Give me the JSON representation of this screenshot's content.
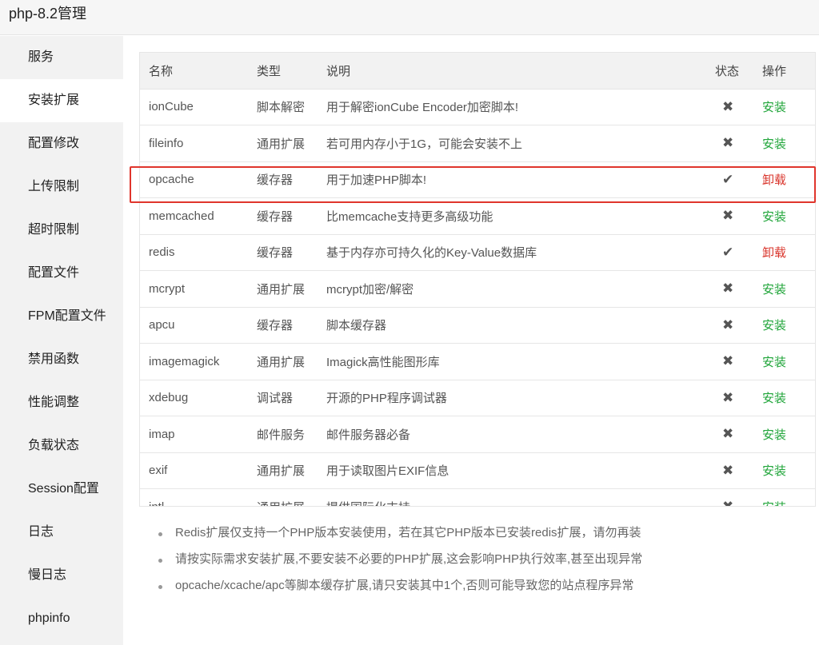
{
  "window": {
    "title": "php-8.2管理"
  },
  "sidebar": {
    "items": [
      {
        "label": "服务"
      },
      {
        "label": "安装扩展"
      },
      {
        "label": "配置修改"
      },
      {
        "label": "上传限制"
      },
      {
        "label": "超时限制"
      },
      {
        "label": "配置文件"
      },
      {
        "label": "FPM配置文件"
      },
      {
        "label": "禁用函数"
      },
      {
        "label": "性能调整"
      },
      {
        "label": "负载状态"
      },
      {
        "label": "Session配置"
      },
      {
        "label": "日志"
      },
      {
        "label": "慢日志"
      },
      {
        "label": "phpinfo"
      }
    ],
    "active_index": 1
  },
  "table": {
    "headers": {
      "name": "名称",
      "type": "类型",
      "desc": "说明",
      "status": "状态",
      "op": "操作"
    },
    "rows": [
      {
        "name": "ionCube",
        "type": "脚本解密",
        "desc": "用于解密ionCube Encoder加密脚本!",
        "status": "✖",
        "installed": false,
        "op": "安装"
      },
      {
        "name": "fileinfo",
        "type": "通用扩展",
        "desc": "若可用内存小于1G，可能会安装不上",
        "status": "✖",
        "installed": false,
        "op": "安装"
      },
      {
        "name": "opcache",
        "type": "缓存器",
        "desc": "用于加速PHP脚本!",
        "status": "✔",
        "installed": true,
        "op": "卸载"
      },
      {
        "name": "memcached",
        "type": "缓存器",
        "desc": "比memcache支持更多高级功能",
        "status": "✖",
        "installed": false,
        "op": "安装"
      },
      {
        "name": "redis",
        "type": "缓存器",
        "desc": "基于内存亦可持久化的Key-Value数据库",
        "status": "✔",
        "installed": true,
        "op": "卸载"
      },
      {
        "name": "mcrypt",
        "type": "通用扩展",
        "desc": "mcrypt加密/解密",
        "status": "✖",
        "installed": false,
        "op": "安装"
      },
      {
        "name": "apcu",
        "type": "缓存器",
        "desc": "脚本缓存器",
        "status": "✖",
        "installed": false,
        "op": "安装"
      },
      {
        "name": "imagemagick",
        "type": "通用扩展",
        "desc": "Imagick高性能图形库",
        "status": "✖",
        "installed": false,
        "op": "安装"
      },
      {
        "name": "xdebug",
        "type": "调试器",
        "desc": "开源的PHP程序调试器",
        "status": "✖",
        "installed": false,
        "op": "安装"
      },
      {
        "name": "imap",
        "type": "邮件服务",
        "desc": "邮件服务器必备",
        "status": "✖",
        "installed": false,
        "op": "安装"
      },
      {
        "name": "exif",
        "type": "通用扩展",
        "desc": "用于读取图片EXIF信息",
        "status": "✖",
        "installed": false,
        "op": "安装"
      },
      {
        "name": "intl",
        "type": "通用扩展",
        "desc": "提供国际化支持",
        "status": "✖",
        "installed": false,
        "op": "安装"
      }
    ]
  },
  "notes": [
    "Redis扩展仅支持一个PHP版本安装使用，若在其它PHP版本已安装redis扩展，请勿再装",
    "请按实际需求安装扩展,不要安装不必要的PHP扩展,这会影响PHP执行效率,甚至出现异常",
    "opcache/xcache/apc等脚本缓存扩展,请只安装其中1个,否则可能导致您的站点程序异常"
  ],
  "colors": {
    "install": "#20a53a",
    "uninstall": "#d9342b",
    "highlight": "#e0352c"
  }
}
